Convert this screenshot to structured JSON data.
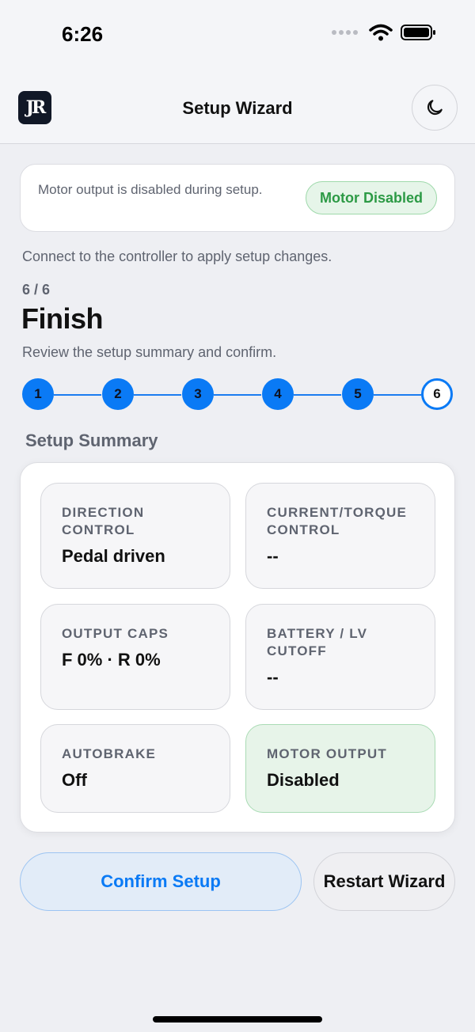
{
  "status_bar": {
    "time": "6:26"
  },
  "header": {
    "logo_text": "JR",
    "title": "Setup Wizard"
  },
  "notice": {
    "text": "Motor output is disabled during setup.",
    "badge": "Motor Disabled"
  },
  "connect_message": "Connect to the controller to apply setup changes.",
  "step": {
    "counter": "6 / 6",
    "title": "Finish",
    "description": "Review the setup summary and confirm.",
    "steps": [
      "1",
      "2",
      "3",
      "4",
      "5",
      "6"
    ],
    "current": 6
  },
  "summary": {
    "heading": "Setup Summary",
    "tiles": [
      {
        "label": "Direction control",
        "value": "Pedal driven"
      },
      {
        "label": "Current/torque control",
        "value": "--"
      },
      {
        "label": "Output caps",
        "value": "F 0% · R 0%"
      },
      {
        "label": "Battery / LV cutoff",
        "value": "--"
      },
      {
        "label": "Autobrake",
        "value": "Off"
      },
      {
        "label": "Motor output",
        "value": "Disabled"
      }
    ]
  },
  "actions": {
    "confirm": "Confirm Setup",
    "restart": "Restart Wizard"
  },
  "colors": {
    "accent": "#0a7af5",
    "success": "#2c9a45"
  }
}
